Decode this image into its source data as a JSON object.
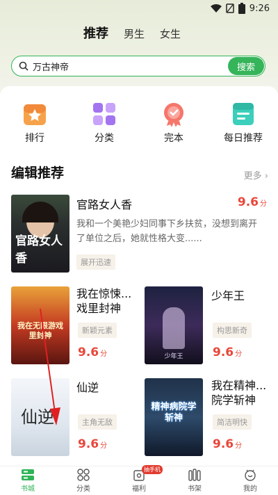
{
  "status": {
    "time": "9:26"
  },
  "tabs": [
    {
      "label": "推荐"
    },
    {
      "label": "男生"
    },
    {
      "label": "女生"
    }
  ],
  "search": {
    "query": "万古神帝",
    "button": "搜索"
  },
  "categories": [
    {
      "label": "排行",
      "icon": "rank-icon"
    },
    {
      "label": "分类",
      "icon": "category-icon"
    },
    {
      "label": "完本",
      "icon": "completed-icon"
    },
    {
      "label": "每日推荐",
      "icon": "daily-icon"
    }
  ],
  "section": {
    "title": "编辑推荐",
    "more": "更多"
  },
  "featured": {
    "title": "官路女人香",
    "score": "9.6",
    "unit": "分",
    "desc": "我和一个美艳少妇同事下乡扶贫，没想到离开了单位之后，她就性格大变......",
    "tag": "展开迅速",
    "cover_text": "官路女人香"
  },
  "books": [
    {
      "title": "我在惊悚戏里封神",
      "title_display": "我在惊悚...戏里封神",
      "tag": "新颖元素",
      "score": "9.6",
      "unit": "分",
      "cover_text": "我在无限游戏里封神"
    },
    {
      "title": "少年王",
      "tag": "构思新奇",
      "score": "9.6",
      "unit": "分",
      "cover_text": "少年王"
    },
    {
      "title": "仙逆",
      "tag": "主角无敌",
      "score": "9.6",
      "unit": "分",
      "cover_text": "仙逆"
    },
    {
      "title": "我在精神病院学斩神",
      "title_display": "我在精神...院学斩神",
      "tag": "简洁明快",
      "score": "9.6",
      "unit": "分",
      "cover_text": "精神病院学斩神"
    }
  ],
  "nav": [
    {
      "label": "书城",
      "active": true
    },
    {
      "label": "分类"
    },
    {
      "label": "福利",
      "badge": "抽手机"
    },
    {
      "label": "书架"
    },
    {
      "label": "我的"
    }
  ],
  "colors": {
    "accent": "#36b45a",
    "score": "#e8473a"
  }
}
